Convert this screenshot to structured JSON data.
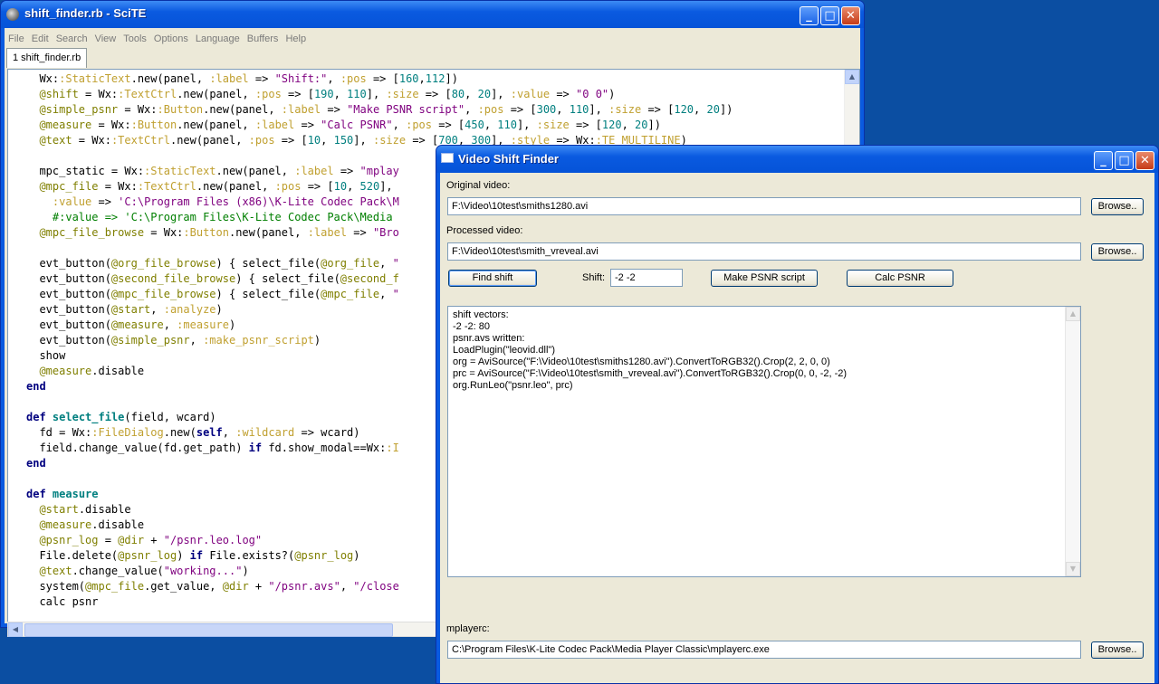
{
  "scite": {
    "title": "shift_finder.rb - SciTE",
    "menu": [
      "File",
      "Edit",
      "Search",
      "View",
      "Tools",
      "Options",
      "Language",
      "Buffers",
      "Help"
    ],
    "tab_label": "1 shift_finder.rb",
    "code_lines": [
      "  Wx::StaticText.new(panel, :label => \"Shift:\", :pos => [160,112])",
      "  @shift = Wx::TextCtrl.new(panel, :pos => [190, 110], :size => [80, 20], :value => \"0 0\")",
      "  @simple_psnr = Wx::Button.new(panel, :label => \"Make PSNR script\", :pos => [300, 110], :size => [120, 20])",
      "  @measure = Wx::Button.new(panel, :label => \"Calc PSNR\", :pos => [450, 110], :size => [120, 20])",
      "  @text = Wx::TextCtrl.new(panel, :pos => [10, 150], :size => [700, 300], :style => Wx::TE_MULTILINE)",
      "",
      "  mpc_static = Wx::StaticText.new(panel, :label => \"mplay",
      "  @mpc_file = Wx::TextCtrl.new(panel, :pos => [10, 520],",
      "    :value => 'C:\\Program Files (x86)\\K-Lite Codec Pack\\M",
      "    #:value => 'C:\\Program Files\\K-Lite Codec Pack\\Media",
      "  @mpc_file_browse = Wx::Button.new(panel, :label => \"Bro",
      "",
      "  evt_button(@org_file_browse) { select_file(@org_file, \"",
      "  evt_button(@second_file_browse) { select_file(@second_f",
      "  evt_button(@mpc_file_browse) { select_file(@mpc_file, \"",
      "  evt_button(@start, :analyze)",
      "  evt_button(@measure, :measure)",
      "  evt_button(@simple_psnr, :make_psnr_script)",
      "  show",
      "  @measure.disable",
      "end",
      "",
      "def select_file(field, wcard)",
      "  fd = Wx::FileDialog.new(self, :wildcard => wcard)",
      "  field.change_value(fd.get_path) if fd.show_modal==Wx::I",
      "end",
      "",
      "def measure",
      "  @start.disable",
      "  @measure.disable",
      "  @psnr_log = @dir + \"/psnr.leo.log\"",
      "  File.delete(@psnr_log) if File.exists?(@psnr_log)",
      "  @text.change_value(\"working...\")",
      "  system(@mpc_file.get_value, @dir + \"/psnr.avs\", \"/close",
      "  calc psnr"
    ]
  },
  "vsf": {
    "title": "Video Shift Finder",
    "original_label": "Original video:",
    "original_value": "F:\\Video\\10test\\smiths1280.avi",
    "processed_label": "Processed video:",
    "processed_value": "F:\\Video\\10test\\smith_vreveal.avi",
    "browse_label": "Browse..",
    "find_shift_label": "Find shift",
    "shift_label": "Shift:",
    "shift_value": "-2 -2",
    "make_psnr_label": "Make PSNR script",
    "calc_psnr_label": "Calc PSNR",
    "output_text": "shift vectors:\n-2 -2: 80\npsnr.avs written:\nLoadPlugin(\"leovid.dll\")\norg = AviSource(\"F:\\Video\\10test\\smiths1280.avi\").ConvertToRGB32().Crop(2, 2, 0, 0)\nprc = AviSource(\"F:\\Video\\10test\\smith_vreveal.avi\").ConvertToRGB32().Crop(0, 0, -2, -2)\norg.RunLeo(\"psnr.leo\", prc)",
    "mplayerc_label": "mplayerc:",
    "mplayerc_value": "C:\\Program Files\\K-Lite Codec Pack\\Media Player Classic\\mplayerc.exe"
  },
  "caption_buttons": {
    "minimize": "_",
    "maximize": "□",
    "close": "✕"
  }
}
